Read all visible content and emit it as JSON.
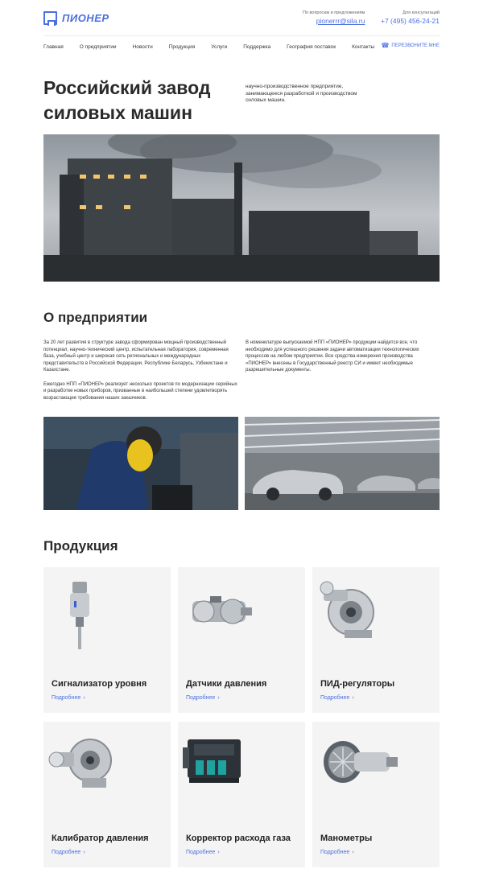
{
  "header": {
    "logo_text": "ПИОНЕР",
    "email_caption": "По вопросам и предложениям",
    "email": "pionerrr@sila.ru",
    "phone_caption": "Для консультаций",
    "phone": "+7 (495) 456-24-21"
  },
  "nav": {
    "items": [
      "Главная",
      "О предприятии",
      "Новости",
      "Продукция",
      "Услуги",
      "Поддержка",
      "География поставок",
      "Контакты"
    ],
    "callback_label": "ПЕРЕЗВОНИТЕ МНЕ",
    "callback_icon": "phone-icon"
  },
  "hero": {
    "title": "Российский завод силовых машин",
    "description": "научно-производственное предприятие, занимающееся разработкой и производством силовых машин."
  },
  "about": {
    "title": "О предприятии",
    "left_p1": "За 20 лет развития в структуре завода сформирован мощный производственный потенциал, научно-технический центр, испытательная лаборатория, современная база, учебный центр и широкая сеть региональных и международных представительств в Российской Федерации, Республике Беларусь, Узбекистане и Казахстане.",
    "left_p2": "Ежегодно НПП «ПИОНЕР» реализует несколько проектов по модернизации серийных и разработке новых приборов, призванные в наибольшей степени удовлетворять возрастающие требования наших заказчиков.",
    "right_p": "В номенклатуре выпускаемой НПП «ПИОНЕР» продукции найдется все, что необходимо для успешного решения задачи автоматизации технологических процессов на любом предприятии. Все средства измерения производства «ПИОНЕР» внесены в Государственный реестр СИ и имеют необходимые разрешительные документы."
  },
  "products": {
    "title": "Продукция",
    "more_label": "Подробнее",
    "items": [
      {
        "name": "Сигнализатор уровня"
      },
      {
        "name": "Датчики давления"
      },
      {
        "name": "ПИД-регуляторы"
      },
      {
        "name": "Калибратор давления"
      },
      {
        "name": "Корректор расхода газа"
      },
      {
        "name": "Манометры"
      }
    ]
  },
  "colors": {
    "accent": "#4a6fe0",
    "card_bg": "#f4f4f4"
  }
}
